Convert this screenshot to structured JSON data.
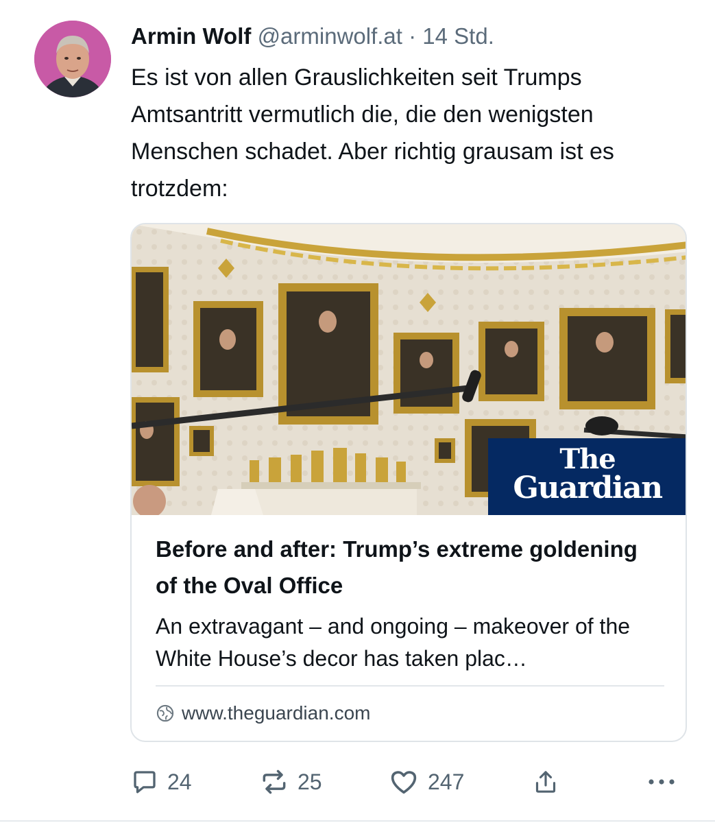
{
  "post": {
    "author_name": "Armin Wolf",
    "handle": "@arminwolf.at",
    "separator": "·",
    "time": "14 Std.",
    "text": "Es ist von allen Grauslichkeiten seit Trumps Amtsantritt vermutlich die, die den wenigsten Menschen schadet. Aber richtig grausam ist es trotzdem:"
  },
  "link_card": {
    "logo_line1": "The",
    "logo_line2": "Guardian",
    "title": "Before and after: Trump’s extreme goldening of the Oval Office",
    "description": "An extravagant – and ongoing – makeover of the White House’s decor has taken plac…",
    "domain": "www.theguardian.com"
  },
  "actions": {
    "replies": "24",
    "reposts": "25",
    "likes": "247"
  },
  "icons": [
    "reply-icon",
    "repost-icon",
    "like-icon",
    "share-icon",
    "more-icon",
    "globe-icon"
  ],
  "colors": {
    "text": "#0f1419",
    "secondary": "#536471",
    "guardian_blue": "#052962",
    "avatar_bg": "#c85aa6"
  }
}
